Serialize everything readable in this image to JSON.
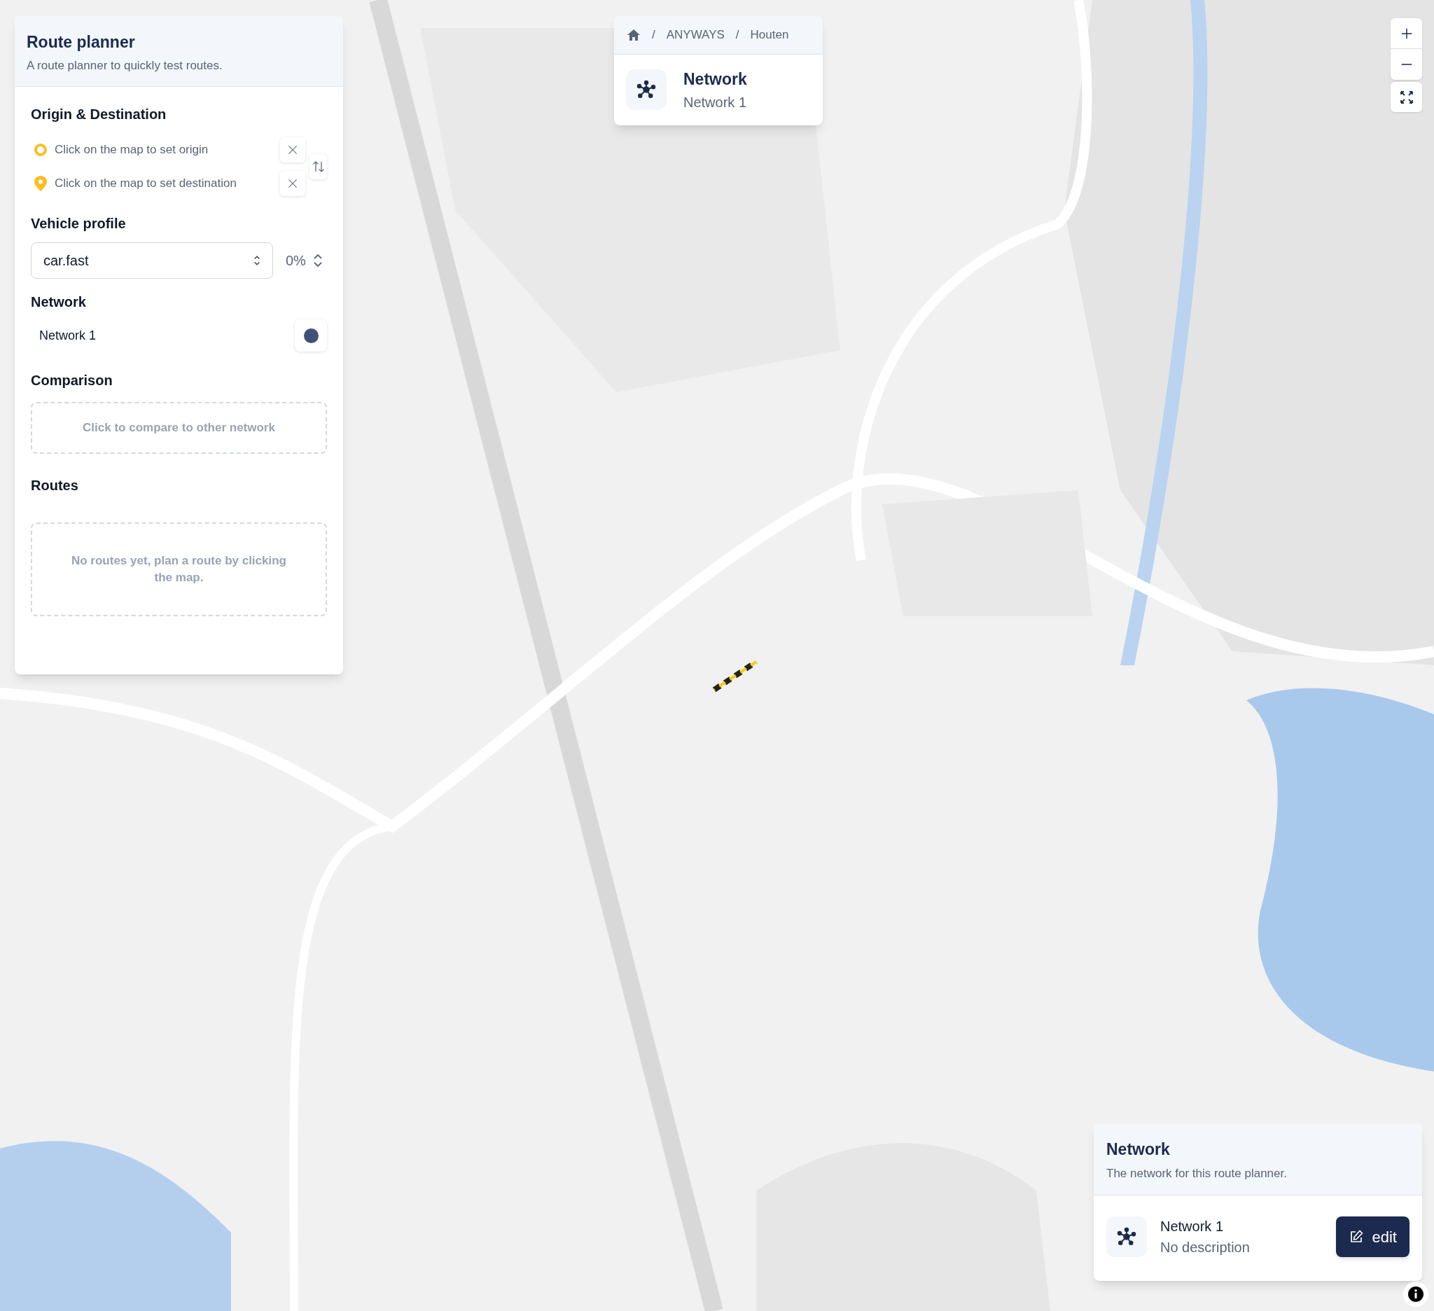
{
  "route_planner": {
    "title": "Route planner",
    "subtitle": "A route planner to quickly test routes.",
    "origin_destination": {
      "heading": "Origin & Destination",
      "points": [
        {
          "kind": "origin",
          "placeholder": "Click on the map to set origin"
        },
        {
          "kind": "destination",
          "placeholder": "Click on the map to set destination"
        }
      ]
    },
    "vehicle_profile": {
      "heading": "Vehicle profile",
      "value": "car.fast",
      "percentage": "0%"
    },
    "network": {
      "heading": "Network",
      "items": [
        {
          "label": "Network 1",
          "color": "#3f5178"
        }
      ]
    },
    "comparison": {
      "heading": "Comparison",
      "action": "Click to compare to other network"
    },
    "routes": {
      "heading": "Routes",
      "empty_message": "No routes yet, plan a route by clicking the map."
    }
  },
  "breadcrumb": {
    "separator": "/",
    "items": [
      "ANYWAYS",
      "Houten"
    ],
    "title": "Network",
    "subtitle": "Network 1"
  },
  "network_card": {
    "title": "Network",
    "subtitle": "The network for this route planner.",
    "name": "Network 1",
    "description": "No description",
    "button": "edit"
  }
}
